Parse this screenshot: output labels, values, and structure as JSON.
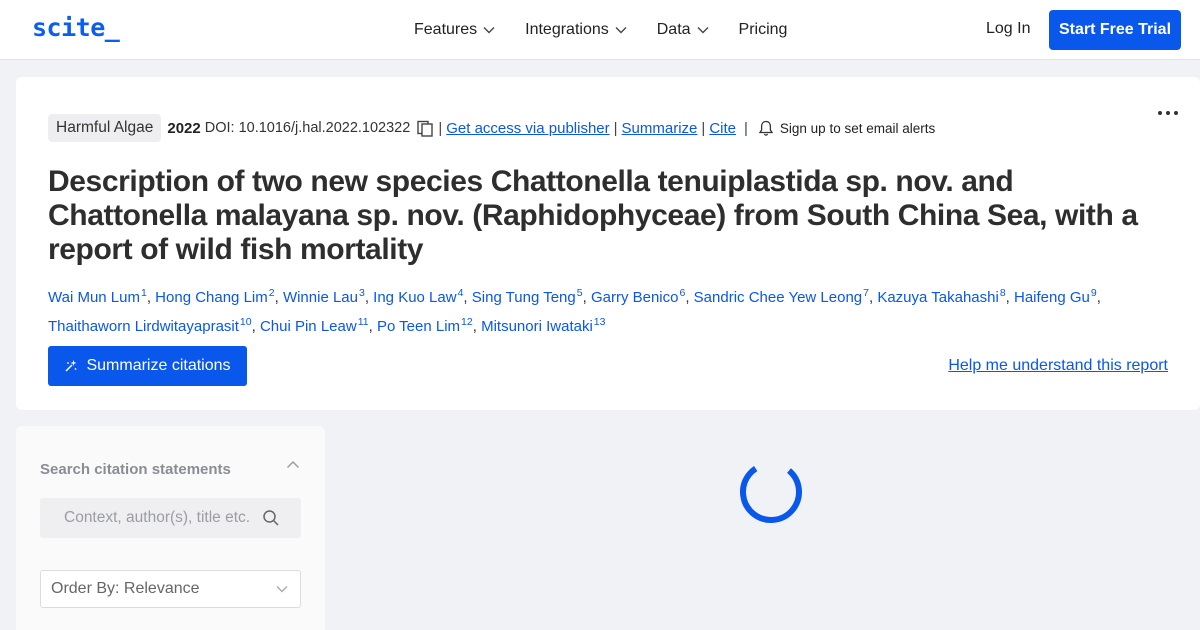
{
  "header": {
    "logo": "scite_",
    "nav": [
      {
        "label": "Features",
        "has_dropdown": true
      },
      {
        "label": "Integrations",
        "has_dropdown": true
      },
      {
        "label": "Data",
        "has_dropdown": true
      },
      {
        "label": "Pricing",
        "has_dropdown": false
      }
    ],
    "login": "Log In",
    "trial": "Start Free Trial"
  },
  "paper": {
    "journal": "Harmful Algae",
    "year": "2022",
    "doi": "DOI: 10.1016/j.hal.2022.102322",
    "links": {
      "publisher": "Get access via publisher",
      "summarize": "Summarize",
      "cite": "Cite",
      "alerts": "Sign up to set email alerts"
    },
    "title": "Description of two new species Chattonella tenuiplastida sp. nov. and Chattonella malayana sp. nov. (Raphidophyceae) from South China Sea, with a report of wild fish mortality",
    "authors": [
      {
        "name": "Wai Mun Lum",
        "sup": "1"
      },
      {
        "name": "Hong Chang Lim",
        "sup": "2"
      },
      {
        "name": "Winnie Lau",
        "sup": "3"
      },
      {
        "name": "Ing Kuo Law",
        "sup": "4"
      },
      {
        "name": "Sing Tung Teng",
        "sup": "5"
      },
      {
        "name": "Garry Benico",
        "sup": "6"
      },
      {
        "name": "Sandric Chee Yew Leong",
        "sup": "7"
      },
      {
        "name": "Kazuya Takahashi",
        "sup": "8"
      },
      {
        "name": "Haifeng Gu",
        "sup": "9"
      },
      {
        "name": "Thaithaworn Lirdwitayaprasit",
        "sup": "10"
      },
      {
        "name": "Chui Pin Leaw",
        "sup": "11"
      },
      {
        "name": "Po Teen Lim",
        "sup": "12"
      },
      {
        "name": "Mitsunori Iwataki",
        "sup": "13"
      }
    ],
    "summarize_button": "Summarize citations",
    "help_link": "Help me understand this report"
  },
  "sidebar": {
    "heading": "Search citation statements",
    "search_placeholder": "Context, author(s), title etc.",
    "order_by": "Order By: Relevance"
  },
  "colors": {
    "accent": "#0a57ec",
    "background": "#f1f2f5"
  }
}
